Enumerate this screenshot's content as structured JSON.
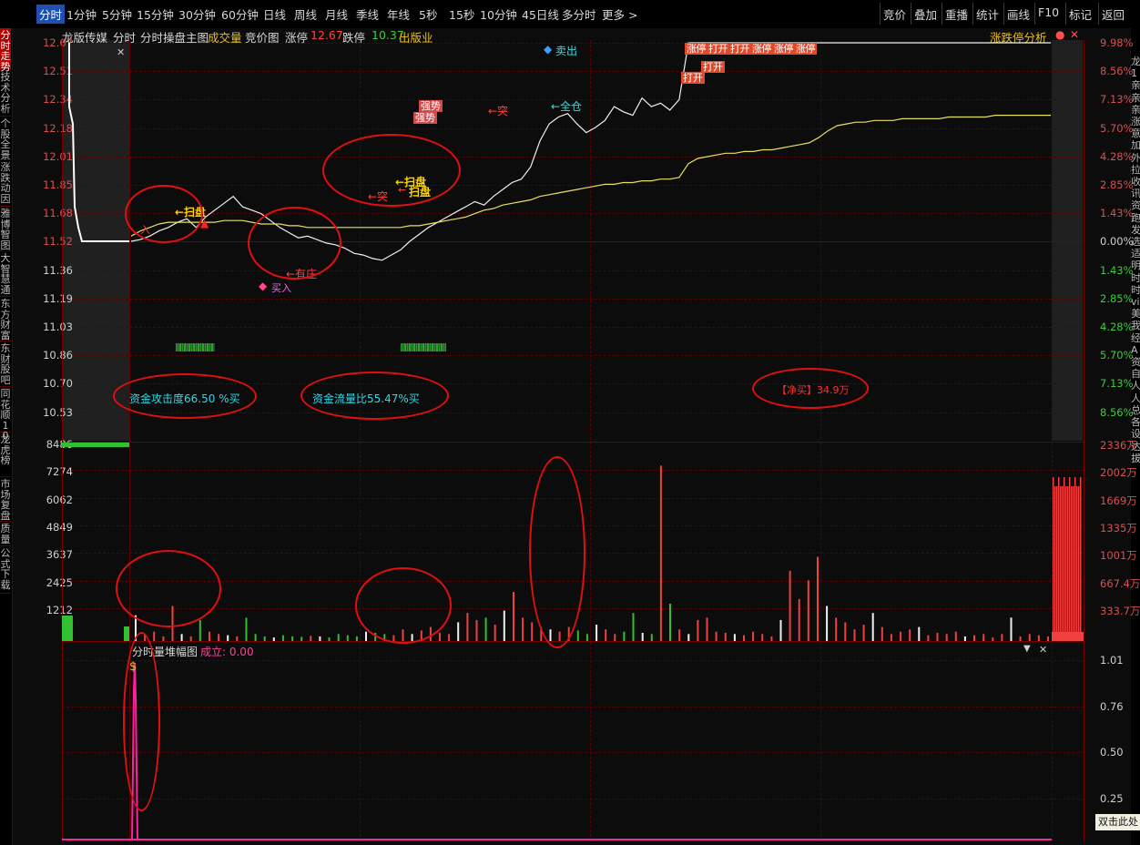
{
  "toolbar": {
    "left_items": [
      "分时",
      "1分钟",
      "5分钟",
      "15分钟",
      "30分钟",
      "60分钟",
      "日线",
      "周线",
      "月线",
      "季线",
      "年线",
      "5秒",
      "15秒",
      "10分钟",
      "45日线",
      "多分时",
      "更多 >"
    ],
    "right_items": [
      "竞价",
      "叠加",
      "重播",
      "统计",
      "画线",
      "F10",
      "标记",
      "返回"
    ]
  },
  "left_tabs": [
    "分时走势",
    "技术分析",
    "个股全景",
    "涨跌动因",
    "雅博智图",
    "大智慧通",
    "东方财富",
    "东财股吧",
    "同花顺10",
    "龙虎榜",
    "市场复盘",
    "质量",
    "公式下载"
  ],
  "right_strip_text": "龙1亲亲亲涨意加外拉收讯资跑发选适明时时vi美我经A资自人人总各设达拔",
  "header": {
    "stock_name": "龙版传媒",
    "items": [
      {
        "text": "分时",
        "color": "#d8d8d8"
      },
      {
        "text": "分时操盘主图",
        "color": "#d8d8d8"
      },
      {
        "text": "成交量",
        "color": "#e8c020"
      },
      {
        "text": "竞价图",
        "color": "#d8d8d8"
      },
      {
        "text": "涨停",
        "color": "#d8d8d8"
      },
      {
        "text": "12.67",
        "color": "#ff4040"
      },
      {
        "text": "跌停",
        "color": "#d8d8d8"
      },
      {
        "text": "10.37",
        "color": "#3ccc3c"
      },
      {
        "text": "出版业",
        "color": "#e8c020"
      }
    ],
    "right_link": "涨跌停分析"
  },
  "price_axis": {
    "left": [
      "12.67",
      "12.51",
      "12.34",
      "12.18",
      "12.01",
      "11.85",
      "11.68",
      "11.52",
      "11.36",
      "11.19",
      "11.03",
      "10.86",
      "10.70",
      "10.53"
    ],
    "right": [
      "9.98%",
      "8.56%",
      "7.13%",
      "5.70%",
      "4.28%",
      "2.85%",
      "1.43%",
      "0.00%",
      "1.43%",
      "2.85%",
      "4.28%",
      "5.70%",
      "7.13%",
      "8.56%"
    ]
  },
  "volume_axis": {
    "left": [
      "8486",
      "7274",
      "6062",
      "4849",
      "3637",
      "2425",
      "1212"
    ],
    "right": [
      "2336万",
      "2002万",
      "1669万",
      "1335万",
      "1001万",
      "667.4万",
      "333.7万"
    ]
  },
  "sub_axis": {
    "right": [
      "1.01",
      "0.76",
      "0.50",
      "0.25"
    ]
  },
  "sub_panel": {
    "title": "分时量堆幅图",
    "value_label": "成立: 0.00"
  },
  "annotations": {
    "attack": "资金攻击度66.50 %买",
    "flow": "资金流量比55.47%买",
    "net_buy": "【净买】34.9万",
    "sweep1": "←扫盘",
    "sweep2": "←扫盘",
    "sweep3": "扫盘",
    "breakout1": "←突",
    "breakout2": "←突",
    "strong1": "强势",
    "strong2": "强势",
    "zhuang": "←有庄",
    "buy": "买入",
    "full": "←全仓",
    "sell": "卖出",
    "limit_tags": "涨停 打开 打开 涨停 涨停 涨停",
    "open1": "打开",
    "open2": "打开",
    "enter": "入",
    "dbl_click": "双击此处"
  },
  "price_series": [
    11.52,
    11.53,
    11.55,
    11.58,
    11.6,
    11.63,
    11.65,
    11.6,
    11.66,
    11.7,
    11.74,
    11.78,
    11.72,
    11.7,
    11.68,
    11.64,
    11.6,
    11.57,
    11.54,
    11.55,
    11.53,
    11.51,
    11.5,
    11.48,
    11.45,
    11.44,
    11.42,
    11.41,
    11.44,
    11.47,
    11.52,
    11.56,
    11.6,
    11.63,
    11.66,
    11.69,
    11.72,
    11.75,
    11.73,
    11.78,
    11.82,
    11.86,
    11.88,
    11.95,
    12.1,
    12.2,
    12.24,
    12.26,
    12.2,
    12.15,
    12.18,
    12.22,
    12.3,
    12.27,
    12.25,
    12.35,
    12.3,
    12.32,
    12.28,
    12.34,
    12.67,
    12.67,
    12.67,
    12.67,
    12.67,
    12.67,
    12.67,
    12.67,
    12.67,
    12.67,
    12.67,
    12.67,
    12.67,
    12.67,
    12.67,
    12.67,
    12.67,
    12.67,
    12.67,
    12.67,
    12.67,
    12.67,
    12.67,
    12.67,
    12.67,
    12.67,
    12.67,
    12.67,
    12.67,
    12.67,
    12.67,
    12.67,
    12.67,
    12.67,
    12.67,
    12.67,
    12.67,
    12.67,
    12.67,
    12.67
  ],
  "avg_series": [
    11.55,
    11.58,
    11.6,
    11.62,
    11.63,
    11.63,
    11.63,
    11.63,
    11.63,
    11.63,
    11.64,
    11.64,
    11.64,
    11.63,
    11.62,
    11.62,
    11.62,
    11.61,
    11.61,
    11.6,
    11.6,
    11.6,
    11.6,
    11.6,
    11.6,
    11.6,
    11.6,
    11.6,
    11.6,
    11.6,
    11.61,
    11.61,
    11.62,
    11.63,
    11.64,
    11.65,
    11.66,
    11.68,
    11.7,
    11.71,
    11.73,
    11.74,
    11.75,
    11.76,
    11.78,
    11.79,
    11.8,
    11.81,
    11.82,
    11.83,
    11.84,
    11.85,
    11.85,
    11.86,
    11.86,
    11.87,
    11.87,
    11.88,
    11.88,
    11.89,
    11.97,
    12.0,
    12.01,
    12.02,
    12.03,
    12.03,
    12.04,
    12.04,
    12.05,
    12.05,
    12.06,
    12.07,
    12.08,
    12.09,
    12.12,
    12.16,
    12.19,
    12.2,
    12.21,
    12.21,
    12.22,
    12.22,
    12.22,
    12.23,
    12.23,
    12.23,
    12.23,
    12.23,
    12.24,
    12.24,
    12.24,
    12.24,
    12.24,
    12.25,
    12.25,
    12.25,
    12.25,
    12.25,
    12.25,
    12.25
  ],
  "volume_series": [
    1100,
    300,
    400,
    200,
    1500,
    300,
    200,
    900,
    400,
    300,
    250,
    200,
    1000,
    300,
    200,
    150,
    250,
    200,
    180,
    220,
    200,
    150,
    300,
    250,
    200,
    400,
    350,
    300,
    250,
    500,
    300,
    450,
    600,
    350,
    300,
    800,
    1200,
    900,
    1000,
    700,
    1300,
    2100,
    1000,
    800,
    600,
    500,
    400,
    600,
    450,
    300,
    700,
    500,
    300,
    400,
    1200,
    350,
    300,
    7500,
    1600,
    500,
    300,
    900,
    1000,
    400,
    350,
    300,
    250,
    400,
    300,
    200,
    900,
    3000,
    1800,
    2600,
    3600,
    1500,
    1000,
    800,
    500,
    700,
    1200,
    600,
    300,
    400,
    500,
    600,
    250,
    350,
    300,
    400,
    200,
    250,
    300,
    150,
    300,
    1000,
    200,
    300,
    250,
    200
  ],
  "sub_series": [
    0,
    1.01,
    0,
    0,
    0,
    0,
    0,
    0,
    0,
    0
  ]
}
